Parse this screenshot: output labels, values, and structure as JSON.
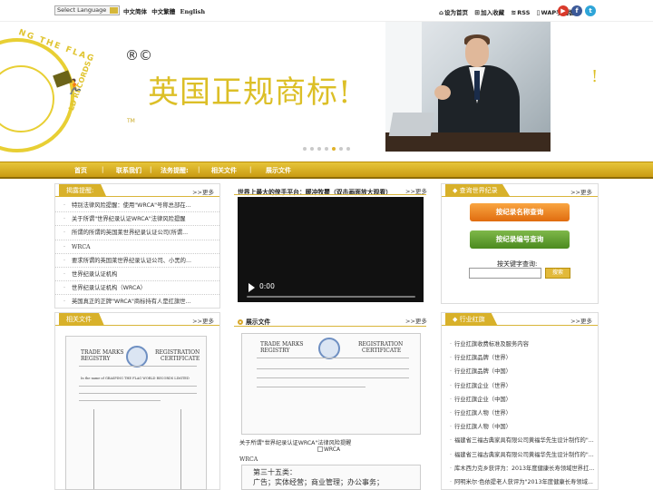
{
  "topbar": {
    "language_select": "Select Language",
    "lang_simplified": "中文简体",
    "lang_traditional": "中文繁體",
    "lang_english": "English",
    "set_home": "设为首页",
    "add_favorite": "加入收藏",
    "rss": "RSS",
    "wap": "WAP手机版",
    "social": [
      "youtube-icon",
      "facebook-icon",
      "twitter-icon"
    ],
    "social_colors": [
      "#d93a2b",
      "#3b5998",
      "#2fa5d8"
    ]
  },
  "banner": {
    "title": "英国正规商标!",
    "reg_marks": "®©",
    "tm": "TM",
    "logo_top_text": "NG THE FLAG",
    "logo_bottom_text": "LD RECORDS",
    "edge_glyph": "!",
    "slides_total": 7,
    "slide_active_index": 4
  },
  "nav": {
    "items": [
      "首页",
      "联系我们",
      "法务提醒:",
      "相关文件",
      "展示文件"
    ]
  },
  "legal_panel": {
    "tab": "揭露提醒:",
    "more": ">>更多",
    "items": [
      "特别法律风险提醒：使用\"WRCA\"号称总部在...",
      "关于所谓\"世界纪录认证WRCA\"法律风险提醒",
      "所谓的所谓的英国莱世界纪录认证公司(所谓...",
      "WRCA",
      "要求所谓的英国莱世界纪录认证公司、小黑的...",
      "世界纪录认证机构",
      "世界纪录认证机构（WRCA）",
      "英国真正的正牌\"WRCA\"商标持有人是扛旗世..."
    ]
  },
  "video_panel": {
    "title": "世界上最大的侠手平台：暖冲牧瞿（双击画面放大观看）",
    "more": ">>更多",
    "time": "0:00"
  },
  "query_panel": {
    "tab": "查询世界纪录",
    "more": ">>更多",
    "button_name": "按纪录名称查询",
    "button_number": "按纪录编号查询",
    "keyword_label": "按关键字查询:",
    "search_value": "",
    "search_button": "搜索"
  },
  "related_panel": {
    "tab": "相关文件",
    "more": ">>更多"
  },
  "display_panel": {
    "title": "展示文件",
    "more": ">>更多",
    "caption1": "关于所谓\"世界纪录认证WRCA\"法律风险提醒",
    "broken_alt": "WRCA",
    "caption2": "WRCA"
  },
  "industry_panel": {
    "tab": "行业红旗",
    "more": ">>更多",
    "items": [
      "行业扛旗收费标准及服务内容",
      "行业扛旗品牌（世界）",
      "行业扛旗品牌（中国）",
      "行业扛旗企业（世界）",
      "行业扛旗企业（中国）",
      "行业扛旗人物（世界）",
      "行业扛旗人物（中国）",
      "福建省三福古典家具有限公司黄福华先生设计制作的\"...",
      "福建省三福古典家具有限公司黄福华先生设计制作的\"...",
      "库木西力克乡获评为：2013年度健康长寿领域世界扛...",
      "阿明米尔·色依提老人获评为\"2013年度健康长寿领域..."
    ]
  },
  "certificate": {
    "heading_left": "TRADE MARKS",
    "heading_left2": "REGISTRY",
    "heading_right": "REGISTRATION",
    "heading_right2": "CERTIFICATE",
    "line": "In the name of GRASPING THE FLAG WORLD RECORDS LIMITED",
    "cn_line1": "第三十五类：",
    "cn_line2": "广告；实体经营；商业管理；办公事务；"
  }
}
